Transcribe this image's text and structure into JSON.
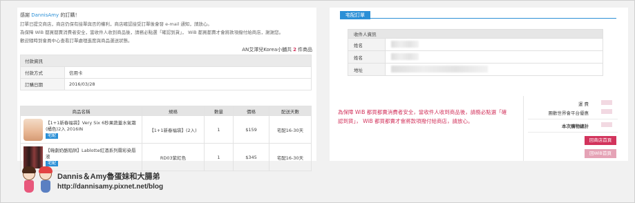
{
  "order_notice": {
    "thanks_prefix": "感謝",
    "customer": "DannisAmy",
    "thanks_suffix": "的訂購！",
    "lines": [
      "訂單已提交商店，商店仍保有接單與否的權利，商店確認接受訂單後會發 e-mail 通知，請放心。",
      "為保障 WiB 都買都賣消費者安全，當收件人收到商品後，請務必點選「確認到貨」， WiB 都買都賣才會將款項撥付給商店，謝謝您。",
      "歡迎隨時到會員中心查看訂單處理進度與商品運送狀態。"
    ],
    "store": "AN艾澤兒Korea小舖共",
    "item_count": "2",
    "item_unit": "件商品"
  },
  "payment": {
    "header": "付款資訊",
    "rows": [
      {
        "label": "付款方式",
        "value": "信用卡"
      },
      {
        "label": "訂購日期",
        "value": "2016/03/28"
      }
    ]
  },
  "products": {
    "columns": [
      "商品名稱",
      "規格",
      "數量",
      "價格",
      "配送天數"
    ],
    "rows": [
      {
        "name": "【1+1新春福袋】Very Six 6秒果蔬蓋水氣霜(橘色)2入 2016IN",
        "tag": "宅配",
        "spec": "【1+1新春福袋】(2入)",
        "qty": "1",
        "price": "$159",
        "ship": "宅配16-30天"
      },
      {
        "name": "【韓劇奶酪陷阱】Lablotte紅酒系列霧彩染唇液",
        "tag": "宅配",
        "spec": "RD03紫紅色",
        "qty": "1",
        "price": "$345",
        "ship": "宅配16-30天"
      }
    ]
  },
  "shipping": {
    "badge": "宅配訂單",
    "header": "收件人資訊",
    "rows": [
      {
        "label": "姓名"
      },
      {
        "label": "姓名"
      },
      {
        "label": "地址"
      }
    ]
  },
  "warning": "為保障 WiB 都買都賣消費者安全，當收件人收到商品後，請務必點選「確認到貨」， WiB 都買都賣才會將款項撥付給商店，請放心。",
  "summary": {
    "shipping_label": "運 費",
    "platform_label": "團歡世界會平台優惠",
    "total_label": "本次購物總計",
    "btn_home": "回商店首頁",
    "btn_wib": "回WiB首頁"
  },
  "watermark": {
    "title": "Dannis＆Amy魯蛋妹和大腸弟",
    "url": "http://dannisamy.pixnet.net/blog"
  },
  "colors": {
    "accent_blue": "#2a8fd6",
    "accent_red": "#d2335c"
  }
}
